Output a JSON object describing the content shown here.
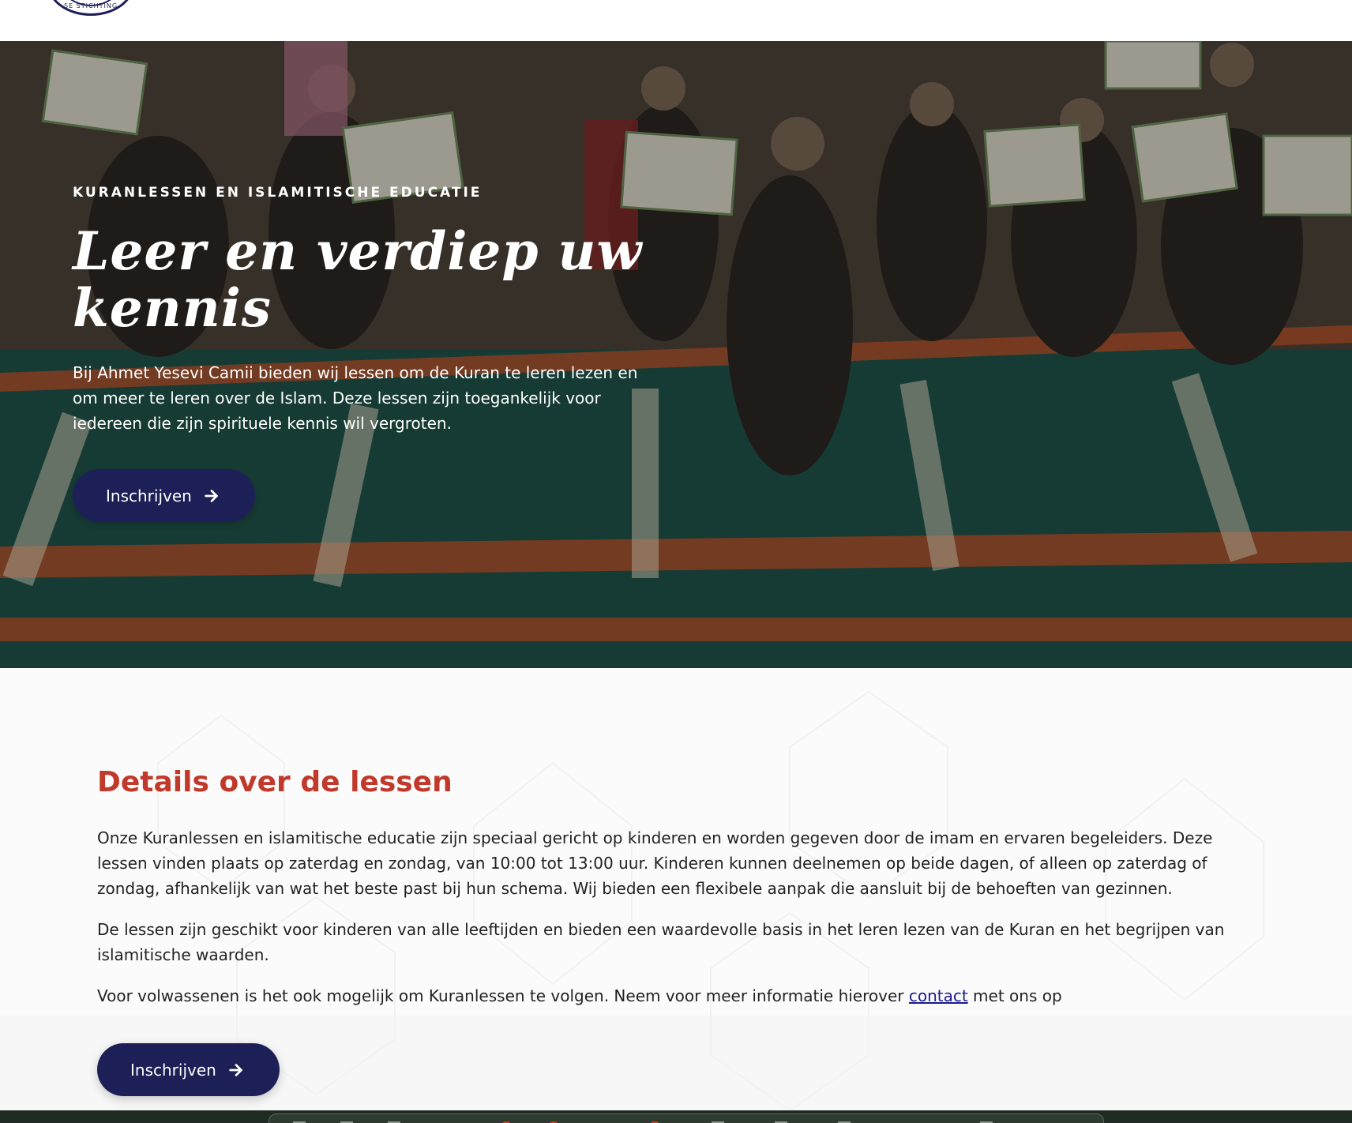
{
  "header": {
    "logo_text": "SE STICHTING"
  },
  "hero": {
    "eyebrow": "KURANLESSEN EN ISLAMITISCHE EDUCATIE",
    "title": "Leer en verdiep uw kennis",
    "text": "Bij Ahmet Yesevi Camii bieden wij lessen om de Kuran te leren lezen en om meer te leren over de Islam. Deze lessen zijn toegankelijk voor iedereen die zijn spirituele kennis wil vergroten.",
    "button_label": "Inschrijven",
    "button_icon": "arrow-right-icon"
  },
  "details": {
    "title": "Details over de lessen",
    "paragraph_1": "Onze Kuranlessen en islamitische educatie zijn speciaal gericht op kinderen en worden gegeven door de imam en ervaren begeleiders. Deze lessen vinden plaats op zaterdag en zondag, van 10:00 tot 13:00 uur. Kinderen kunnen deelnemen op beide dagen, of alleen op zaterdag of zondag, afhankelijk van wat het beste past bij hun schema. Wij bieden een flexibele aanpak die aansluit bij de behoeften van gezinnen.",
    "paragraph_2": "De lessen zijn geschikt voor kinderen van alle leeftijden en bieden een waardevolle basis in het leren lezen van de Kuran en het begrijpen van islamitische waarden.",
    "paragraph_3_before": "Voor volwassenen is het ook mogelijk om Kuranlessen te volgen. Neem voor meer informatie hierover ",
    "paragraph_3_link": "contact",
    "paragraph_3_after": " met ons op",
    "button_label": "Inschrijven",
    "button_icon": "arrow-right-icon"
  },
  "colors": {
    "brand_navy": "#1d2056",
    "accent_red": "#c0392b",
    "link_blue": "#1a1a8c"
  }
}
